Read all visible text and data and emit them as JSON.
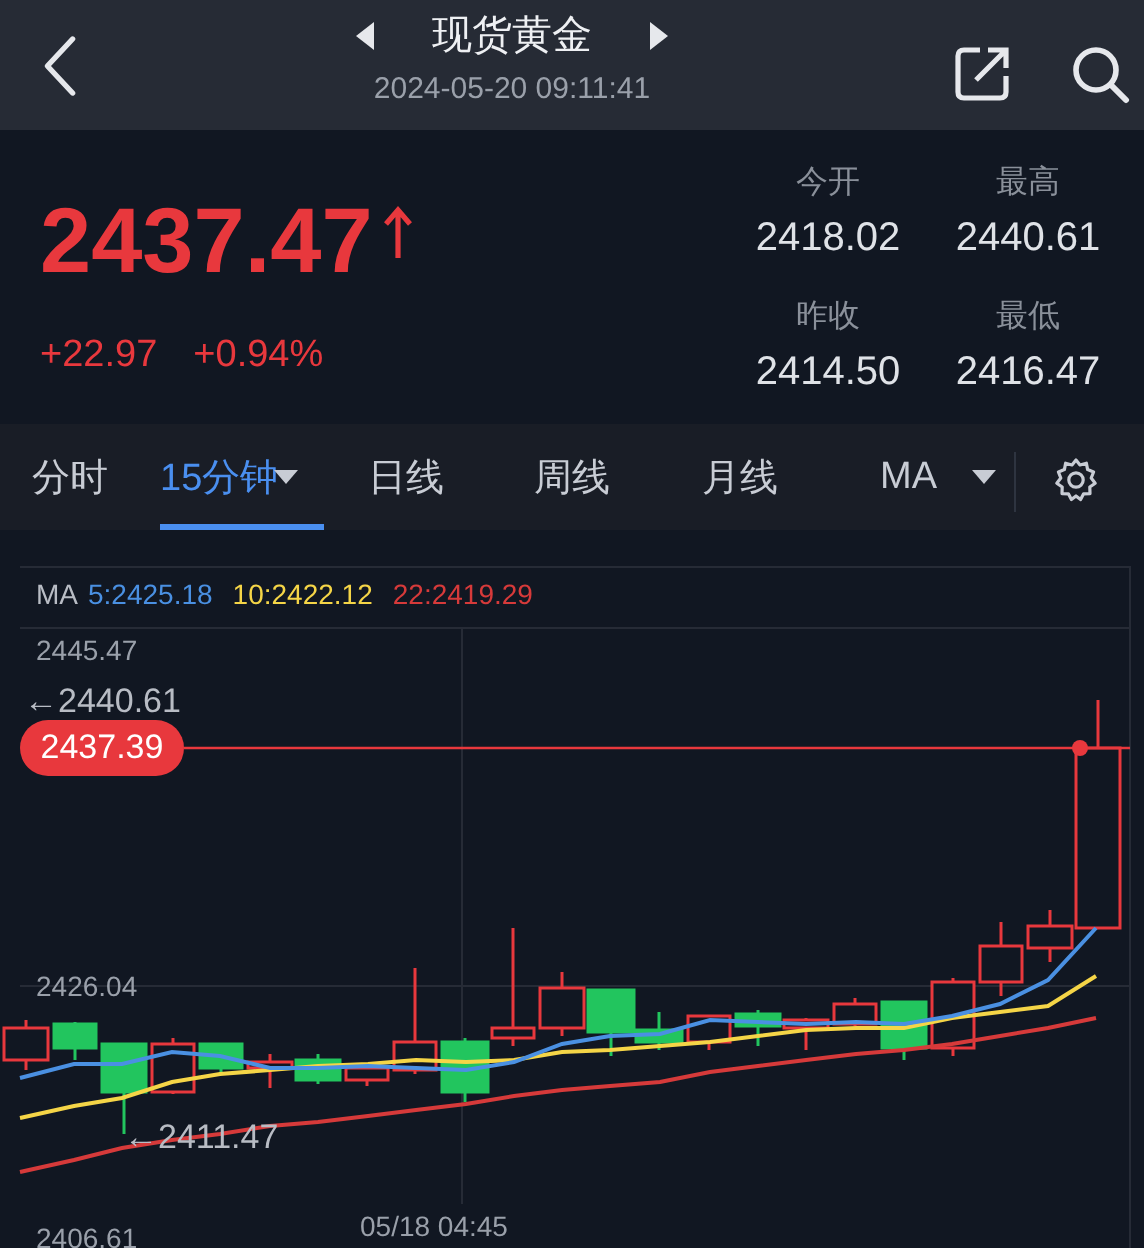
{
  "header": {
    "title": "现货黄金",
    "datetime": "2024-05-20 09:11:41"
  },
  "quote": {
    "price": "2437.47",
    "change": "+22.97",
    "change_pct": "+0.94%",
    "stats": [
      {
        "label": "今开",
        "value": "2418.02"
      },
      {
        "label": "最高",
        "value": "2440.61"
      },
      {
        "label": "昨收",
        "value": "2414.50"
      },
      {
        "label": "最低",
        "value": "2416.47"
      }
    ]
  },
  "tabs": [
    {
      "label": "分时",
      "selected": false,
      "has_menu": false
    },
    {
      "label": "15分钟",
      "selected": true,
      "has_menu": true
    },
    {
      "label": "日线",
      "selected": false,
      "has_menu": false
    },
    {
      "label": "周线",
      "selected": false,
      "has_menu": false
    },
    {
      "label": "月线",
      "selected": false,
      "has_menu": false
    },
    {
      "label": "MA",
      "selected": false,
      "has_menu": true
    }
  ],
  "chart": {
    "legend_label": "MA",
    "ma_legend": [
      {
        "text": "5:2425.18",
        "color": "#4a90e2"
      },
      {
        "text": "10:2422.12",
        "color": "#f5d547"
      },
      {
        "text": "22:2419.29",
        "color": "#d63a3a"
      }
    ],
    "y_labels": [
      "2445.47",
      "2426.04",
      "2406.61"
    ],
    "price_tag": "2437.39",
    "high_marker": "←2440.61",
    "low_marker": "←2411.47",
    "x_label": "05/18 04:45"
  }
}
